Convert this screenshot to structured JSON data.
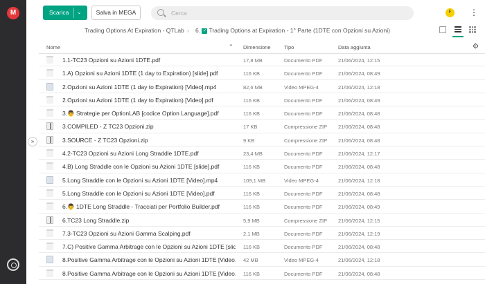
{
  "sidebar": {
    "logo": "M",
    "expand_icon": "»"
  },
  "toolbar": {
    "upload_label": "Scarica",
    "upload_chevron": "⌄",
    "save_label": "Salva in MEGA",
    "search_placeholder": "Cerca",
    "avatar_initial": "F",
    "menu_icon": "⋮"
  },
  "breadcrumb": {
    "parent": "Trading Options At Expiration - QTLab",
    "current_index": "6.",
    "current_check": "✓",
    "current": "Trading Options at Expiration - 1° Parte (1DTE con Opzioni su Azioni)"
  },
  "table": {
    "headers": {
      "name": "Nome",
      "size": "Dimensione",
      "type": "Tipo",
      "date": "Data aggiunta"
    },
    "sort_icon": "⌃",
    "settings_icon": "⚙",
    "rows": [
      {
        "icon": "pdf",
        "name": "1.1-TC23 Opzioni su Azioni 1DTE.pdf",
        "size": "17,8 MB",
        "type": "Documento PDF",
        "date": "21/06/2024, 12:15"
      },
      {
        "icon": "pdf",
        "name": "1.A) Opzioni su Azioni 1DTE (1 day to Expiration) [slide].pdf",
        "size": "116 KB",
        "type": "Documento PDF",
        "date": "21/06/2024, 08:49"
      },
      {
        "icon": "vid",
        "name": "2.Opzioni su Azioni 1DTE (1 day to Expiration) [Video].mp4",
        "size": "82,6 MB",
        "type": "Video MPEG-4",
        "date": "21/06/2024, 12:18"
      },
      {
        "icon": "pdf",
        "name": "2.Opzioni su Azioni 1DTE (1 day to Expiration) [Video].pdf",
        "size": "116 KB",
        "type": "Documento PDF",
        "date": "21/06/2024, 08:49"
      },
      {
        "icon": "pdf",
        "name": "3.👨 Strategie per OptionLAB [codice Option Language].pdf",
        "size": "116 KB",
        "type": "Documento PDF",
        "date": "21/06/2024, 08:48"
      },
      {
        "icon": "zip",
        "name": "3.COMPILED - Z TC23 Opzioni.zip",
        "size": "17 KB",
        "type": "Compressione ZIP",
        "date": "21/06/2024, 08:48"
      },
      {
        "icon": "zip",
        "name": "3.SOURCE - Z TC23 Opzioni.zip",
        "size": "9 KB",
        "type": "Compressione ZIP",
        "date": "21/06/2024, 08:48"
      },
      {
        "icon": "pdf",
        "name": "4.2-TC23 Opzioni su Azioni Long Straddle 1DTE.pdf",
        "size": "23,4 MB",
        "type": "Documento PDF",
        "date": "21/06/2024, 12:17"
      },
      {
        "icon": "pdf",
        "name": "4.B) Long Straddle con le Opzioni su Azioni 1DTE [slide].pdf",
        "size": "116 KB",
        "type": "Documento PDF",
        "date": "21/06/2024, 08:48"
      },
      {
        "icon": "vid",
        "name": "5.Long Straddle con le Opzioni su Azioni 1DTE [Video].mp4",
        "size": "109,1 MB",
        "type": "Video MPEG-4",
        "date": "21/06/2024, 12:18"
      },
      {
        "icon": "pdf",
        "name": "5.Long Straddle con le Opzioni su Azioni 1DTE [Video].pdf",
        "size": "116 KB",
        "type": "Documento PDF",
        "date": "21/06/2024, 08:48"
      },
      {
        "icon": "pdf",
        "name": "6.👨 1DTE Long Straddle - Tracciati per Portfolio Builder.pdf",
        "size": "116 KB",
        "type": "Documento PDF",
        "date": "21/06/2024, 08:49"
      },
      {
        "icon": "zip",
        "name": "6.TC23 Long Straddle.zip",
        "size": "5,9 MB",
        "type": "Compressione ZIP",
        "date": "21/06/2024, 12:15"
      },
      {
        "icon": "pdf",
        "name": "7.3-TC23 Opzioni su Azioni Gamma Scalping.pdf",
        "size": "2,1 MB",
        "type": "Documento PDF",
        "date": "21/06/2024, 12:19"
      },
      {
        "icon": "pdf",
        "name": "7.C) Positive Gamma Arbitrage con le Opzioni su Azioni 1DTE [slid...",
        "size": "116 KB",
        "type": "Documento PDF",
        "date": "21/06/2024, 08:48"
      },
      {
        "icon": "vid",
        "name": "8.Positive Gamma Arbitrage con le Opzioni su Azioni 1DTE [Video...",
        "size": "42 MB",
        "type": "Video MPEG-4",
        "date": "21/06/2024, 12:18"
      },
      {
        "icon": "pdf",
        "name": "8.Positive Gamma Arbitrage con le Opzioni su Azioni 1DTE [Video...",
        "size": "116 KB",
        "type": "Documento PDF",
        "date": "21/06/2024, 08:48"
      }
    ]
  }
}
